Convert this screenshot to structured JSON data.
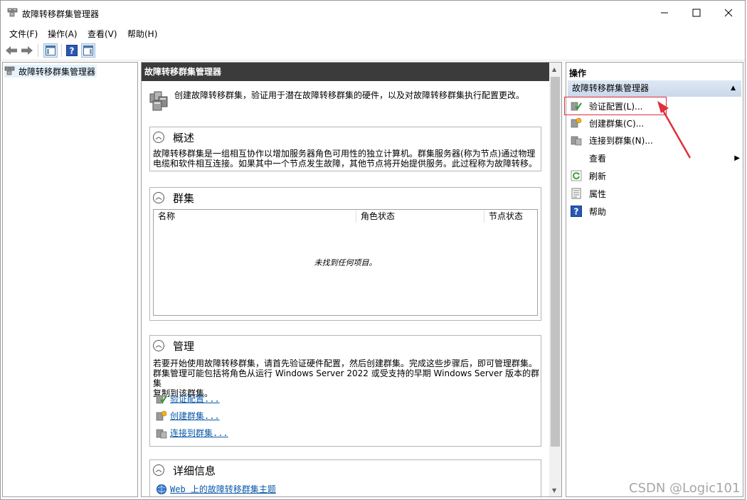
{
  "window": {
    "title": "故障转移群集管理器",
    "minimize": "—",
    "maximize": "☐",
    "close": "✕"
  },
  "menu": [
    "文件(F)",
    "操作(A)",
    "查看(V)",
    "帮助(H)"
  ],
  "toolbar": {
    "icons": [
      "back-arrow-icon",
      "forward-arrow-icon",
      "show-hide-console-tree-icon",
      "help-icon",
      "show-hide-action-pane-icon"
    ]
  },
  "tree": {
    "root_label": "故障转移群集管理器"
  },
  "center": {
    "header": "故障转移群集管理器",
    "intro": "创建故障转移群集，验证用于潜在故障转移群集的硬件，以及对故障转移群集执行配置更改。",
    "overview": {
      "title": "概述",
      "text_line1": "故障转移群集是一组相互协作以增加服务器角色可用性的独立计算机。群集服务器(称为节点)通过物理",
      "text_line2": "电缆和软件相互连接。如果其中一个节点发生故障，其他节点将开始提供服务。此过程称为故障转移。"
    },
    "clusters": {
      "title": "群集",
      "columns": [
        "名称",
        "角色状态",
        "节点状态"
      ],
      "empty_message": "未找到任何项目。"
    },
    "management": {
      "title": "管理",
      "text_line1": "若要开始使用故障转移群集，请首先验证硬件配置，然后创建群集。完成这些步骤后，即可管理群集。",
      "text_line2": "群集管理可能包括将角色从运行 Windows Server 2022 或受支持的早期 Windows Server 版本的群集",
      "text_line3": "复制到该群集。",
      "links": [
        "验证配置...",
        "创建群集...",
        "连接到群集..."
      ]
    },
    "details": {
      "title": "详细信息",
      "link": "Web 上的故障转移群集主题"
    }
  },
  "actions": {
    "header": "操作",
    "group": "故障转移群集管理器",
    "items": [
      "验证配置(L)...",
      "创建群集(C)...",
      "连接到群集(N)...",
      "查看",
      "刷新",
      "属性",
      "帮助"
    ]
  },
  "watermark": "CSDN @Logic101",
  "colors": {
    "accent_red": "#e0303a",
    "header_dark": "#3b3b3b",
    "link_blue": "#0a58a8",
    "group_blue": "#c9d8ea"
  }
}
